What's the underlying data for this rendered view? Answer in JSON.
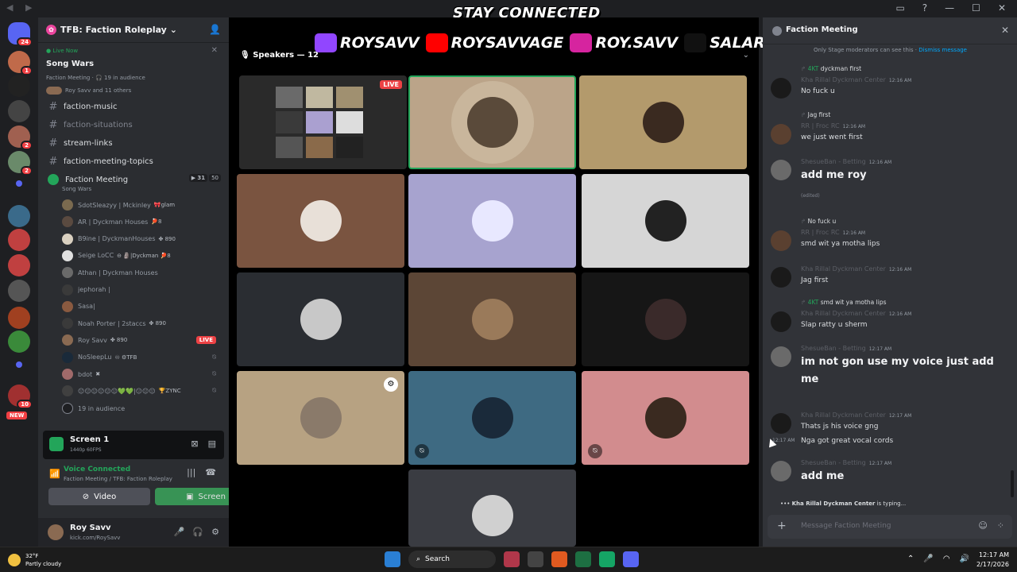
{
  "overlay": {
    "title": "STAY CONNECTED"
  },
  "server": {
    "name": "TFB: Faction Roleplay"
  },
  "guild_badges": {
    "top": "24",
    "b1": "1",
    "b2": "2",
    "b3": "2",
    "b4": "10",
    "new": "NEW"
  },
  "live_now": {
    "label": "Live Now",
    "title": "Song Wars",
    "subtitle": "Faction Meeting · 🎧 19 in audience",
    "users": "Roy Savv and 11 others"
  },
  "channels": [
    {
      "name": "faction-music",
      "dim": false
    },
    {
      "name": "faction-situations",
      "dim": true
    },
    {
      "name": "stream-links",
      "dim": false
    },
    {
      "name": "faction-meeting-topics",
      "dim": false
    }
  ],
  "voice_channel": {
    "name": "Faction Meeting",
    "sub": "Song Wars",
    "count1": "31",
    "count2": "50"
  },
  "members": [
    {
      "name": "SdotSleazyy | Mckinley",
      "tags": "🎀glam",
      "color": "#7a6a4f",
      "live": false,
      "muted": false
    },
    {
      "name": "AR | Dyckman Houses",
      "tags": "🏓8",
      "color": "#5a4a40",
      "live": false,
      "muted": false
    },
    {
      "name": "B9ine | DyckmanHouses",
      "tags": "✤ 890",
      "color": "#d9d0c0",
      "live": false,
      "muted": false
    },
    {
      "name": "Seige LoCC",
      "tags": "⊖ 🗿|Dyckman 🏓8",
      "color": "#e0e0e0",
      "live": false,
      "muted": false
    },
    {
      "name": "Athan | Dyckman Houses",
      "tags": "",
      "color": "#6a6a6a",
      "live": false,
      "muted": false
    },
    {
      "name": "jephorah |",
      "tags": "",
      "color": "#3a3a3a",
      "live": false,
      "muted": false
    },
    {
      "name": "Sasa|",
      "tags": "",
      "color": "#8a5a40",
      "live": false,
      "muted": false
    },
    {
      "name": "Noah Porter | 2staccs",
      "tags": "✤ 890",
      "color": "#3a3a3a",
      "live": false,
      "muted": false
    },
    {
      "name": "Roy Savv",
      "tags": "✤ 890",
      "color": "#8a6a52",
      "live": true,
      "live_label": "LIVE",
      "muted": false
    },
    {
      "name": "NoSleepLu",
      "tags": "♾ ⚙TFB",
      "color": "#1a2a3a",
      "live": false,
      "muted": true
    },
    {
      "name": "bdot",
      "tags": "✖",
      "color": "#a06a6a",
      "live": false,
      "muted": true
    },
    {
      "name": "😐😐😐😐😐😐💚💚|😐😐😐",
      "tags": "🏆ZYNC",
      "color": "#404040",
      "live": false,
      "muted": true
    }
  ],
  "audience": {
    "label": "19 in audience"
  },
  "screenshare": {
    "title": "Screen 1",
    "sub": "1440p 60FPS"
  },
  "voice_connected": {
    "label": "Voice Connected",
    "sub": "Faction Meeting / TFB: Faction Roleplay"
  },
  "buttons": {
    "video": "Video",
    "screen": "Screen"
  },
  "user": {
    "name": "Roy Savv",
    "status": "kick.com/RoySavv"
  },
  "stage": {
    "speakers": "Speakers — 12",
    "socials": [
      {
        "handle": "ROYSAVV",
        "icon": "twitch-icon",
        "color": "#9146ff"
      },
      {
        "handle": "ROYSAVVAGE",
        "icon": "youtube-icon",
        "color": "#ff0000"
      },
      {
        "handle": "ROY.SAVV",
        "icon": "instagram-icon",
        "color": "#d6249f"
      },
      {
        "handle": "SALARYS",
        "icon": "tiktok-icon",
        "color": "#111111"
      }
    ],
    "tile_live": "LIVE"
  },
  "chat": {
    "title": "Faction Meeting",
    "mod_note": "Only Stage moderators can see this ·",
    "dismiss": "Dismiss message",
    "typing_user": "Kha Rillal Dyckman Center",
    "typing_suffix": "is typing...",
    "placeholder": "Message Faction Meeting",
    "messages": [
      {
        "reply": "dyckman first",
        "reply_tag": "4KT",
        "author": "Kha Rillal Dyckman Center",
        "time": "12:16 AM",
        "text": "No fuck u",
        "big": false,
        "color": "#1a1a1a"
      },
      {
        "reply": "Jag first",
        "reply_tag": "",
        "author": "RR | Froc RC",
        "time": "12:16 AM",
        "text": "we just went first",
        "big": false,
        "color": "#5a4030"
      },
      {
        "reply": "",
        "reply_tag": "",
        "author": "ShesueBan - Betting",
        "time": "12:16 AM",
        "text": "add me roy",
        "big": true,
        "edited": "(edited)",
        "color": "#6a6a6a"
      },
      {
        "reply": "No fuck u",
        "reply_tag": "",
        "author": "RR | Froc RC",
        "time": "12:16 AM",
        "text": "smd wit ya motha lips",
        "big": false,
        "color": "#5a4030"
      },
      {
        "reply": "",
        "reply_tag": "",
        "author": "Kha Rillal Dyckman Center",
        "time": "12:16 AM",
        "text": "Jag first",
        "big": false,
        "color": "#1a1a1a"
      },
      {
        "reply": "smd wit ya motha lips",
        "reply_tag": "4KT",
        "author": "Kha Rillal Dyckman Center",
        "time": "12:16 AM",
        "text": "Slap ratty u sherm",
        "big": false,
        "color": "#1a1a1a"
      },
      {
        "reply": "",
        "reply_tag": "",
        "author": "ShesueBan - Betting",
        "time": "12:17 AM",
        "text": "im not gon use my voice just add me",
        "big": true,
        "color": "#6a6a6a"
      },
      {
        "reply": "",
        "reply_tag": "",
        "author": "Kha Rillal Dyckman Center",
        "time": "12:17 AM",
        "text": "Thats js his voice gng",
        "text2": "Nga got great vocal cords",
        "time2": "12:17 AM",
        "big": false,
        "color": "#1a1a1a"
      },
      {
        "reply": "",
        "reply_tag": "",
        "author": "ShesueBan - Betting",
        "time": "12:17 AM",
        "text": "add me",
        "big": true,
        "color": "#6a6a6a"
      }
    ]
  },
  "taskbar": {
    "temp": "32°F",
    "weather": "Partly cloudy",
    "search": "Search",
    "time": "12:17 AM",
    "date": "2/17/2026"
  }
}
